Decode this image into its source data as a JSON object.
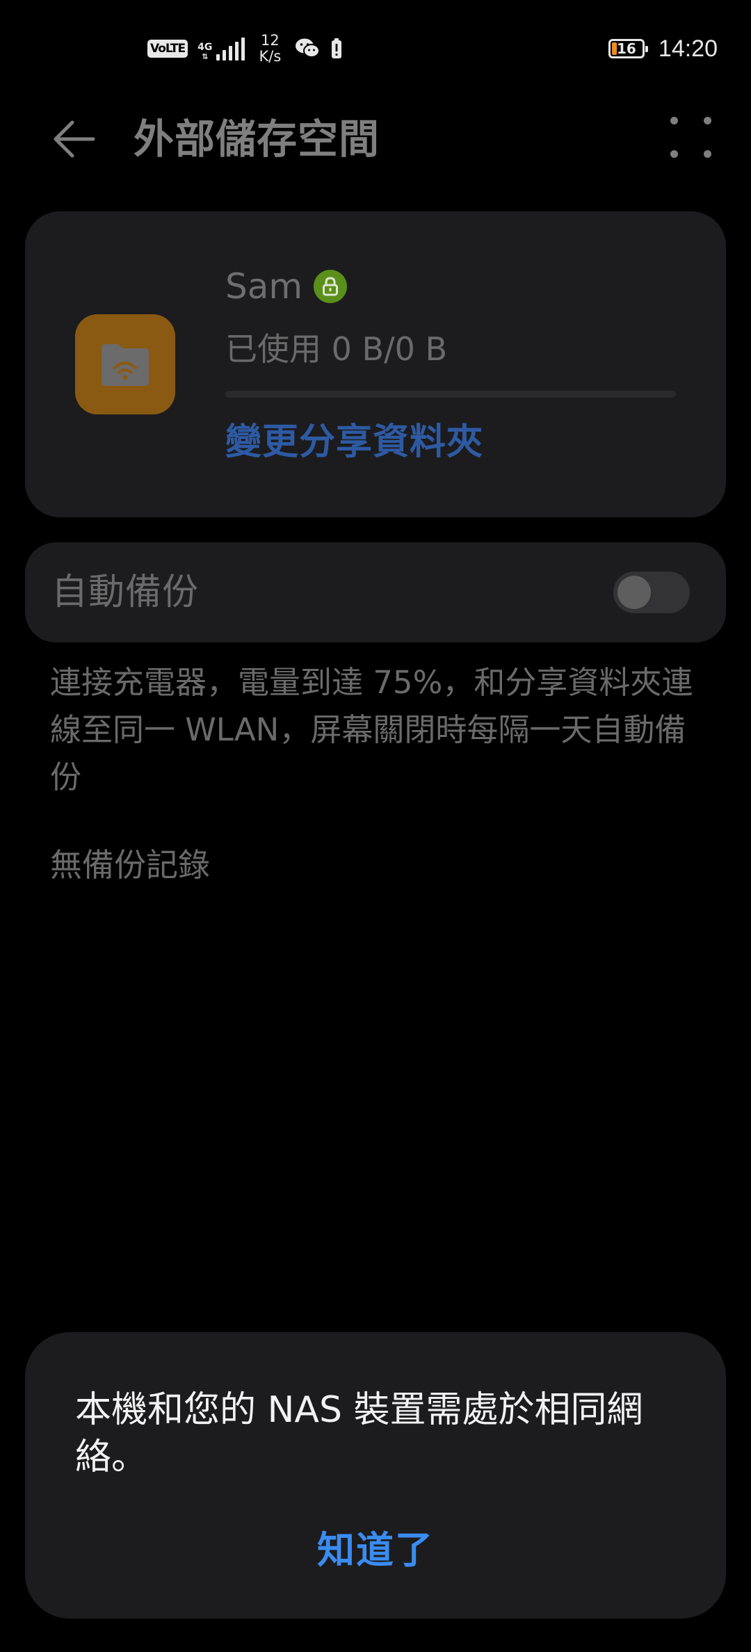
{
  "status_bar": {
    "volte": "VoLTE",
    "network_type": "4G",
    "net_speed_value": "12",
    "net_speed_unit": "K/s",
    "battery_level": "16",
    "time": "14:20",
    "icons": [
      "volte-icon",
      "signal-icon",
      "wechat-icon",
      "alert-icon",
      "battery-icon"
    ]
  },
  "app_bar": {
    "title": "外部儲存空間",
    "back_icon": "back-arrow-icon",
    "more_icon": "more-dots-icon"
  },
  "storage_card": {
    "device_name": "Sam",
    "lock_icon": "lock-icon",
    "folder_icon": "wifi-folder-icon",
    "usage_text": "已使用 0 B/0 B",
    "usage_fraction": 0,
    "change_folder_label": "變更分享資料夾",
    "colors": {
      "folder_tile": "#8a5a12",
      "lock_badge": "#5b8f1b",
      "link": "#2e5aa3"
    }
  },
  "auto_backup": {
    "label": "自動備份",
    "enabled": false,
    "description": "連接充電器，電量到達 75%，和分享資料夾連線至同一 WLAN，屏幕關閉時每隔一天自動備份",
    "history": "無備份記錄"
  },
  "dialog": {
    "message": "本機和您的 NAS 裝置需處於相同網絡。",
    "confirm_label": "知道了",
    "accent_color": "#3a8cf0"
  }
}
